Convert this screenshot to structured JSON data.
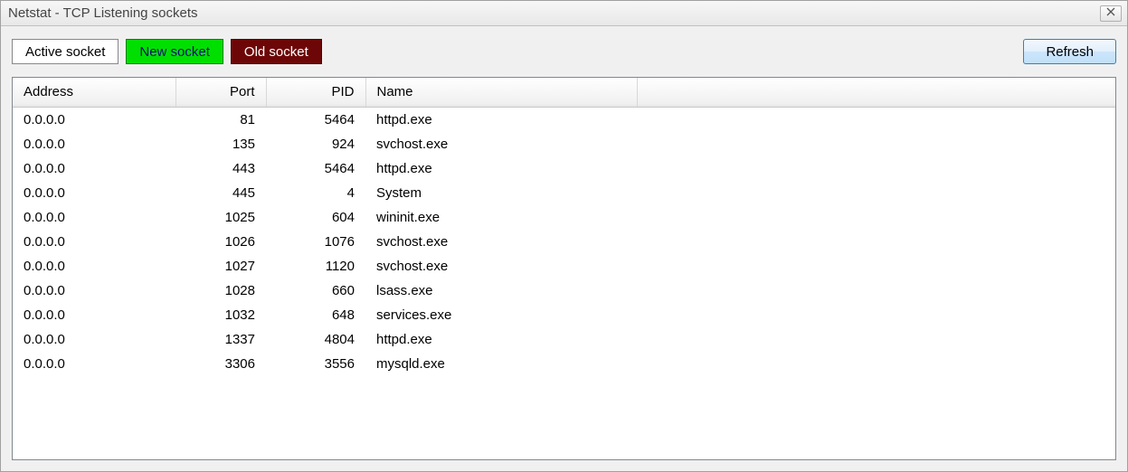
{
  "window": {
    "title": "Netstat - TCP Listening sockets"
  },
  "toolbar": {
    "active_label": "Active socket",
    "new_label": "New socket",
    "old_label": "Old socket",
    "refresh_label": "Refresh"
  },
  "table": {
    "headers": {
      "address": "Address",
      "port": "Port",
      "pid": "PID",
      "name": "Name"
    },
    "rows": [
      {
        "address": "0.0.0.0",
        "port": "81",
        "pid": "5464",
        "name": "httpd.exe"
      },
      {
        "address": "0.0.0.0",
        "port": "135",
        "pid": "924",
        "name": "svchost.exe"
      },
      {
        "address": "0.0.0.0",
        "port": "443",
        "pid": "5464",
        "name": "httpd.exe"
      },
      {
        "address": "0.0.0.0",
        "port": "445",
        "pid": "4",
        "name": "System"
      },
      {
        "address": "0.0.0.0",
        "port": "1025",
        "pid": "604",
        "name": "wininit.exe"
      },
      {
        "address": "0.0.0.0",
        "port": "1026",
        "pid": "1076",
        "name": "svchost.exe"
      },
      {
        "address": "0.0.0.0",
        "port": "1027",
        "pid": "1120",
        "name": "svchost.exe"
      },
      {
        "address": "0.0.0.0",
        "port": "1028",
        "pid": "660",
        "name": "lsass.exe"
      },
      {
        "address": "0.0.0.0",
        "port": "1032",
        "pid": "648",
        "name": "services.exe"
      },
      {
        "address": "0.0.0.0",
        "port": "1337",
        "pid": "4804",
        "name": "httpd.exe"
      },
      {
        "address": "0.0.0.0",
        "port": "3306",
        "pid": "3556",
        "name": "mysqld.exe"
      }
    ]
  }
}
